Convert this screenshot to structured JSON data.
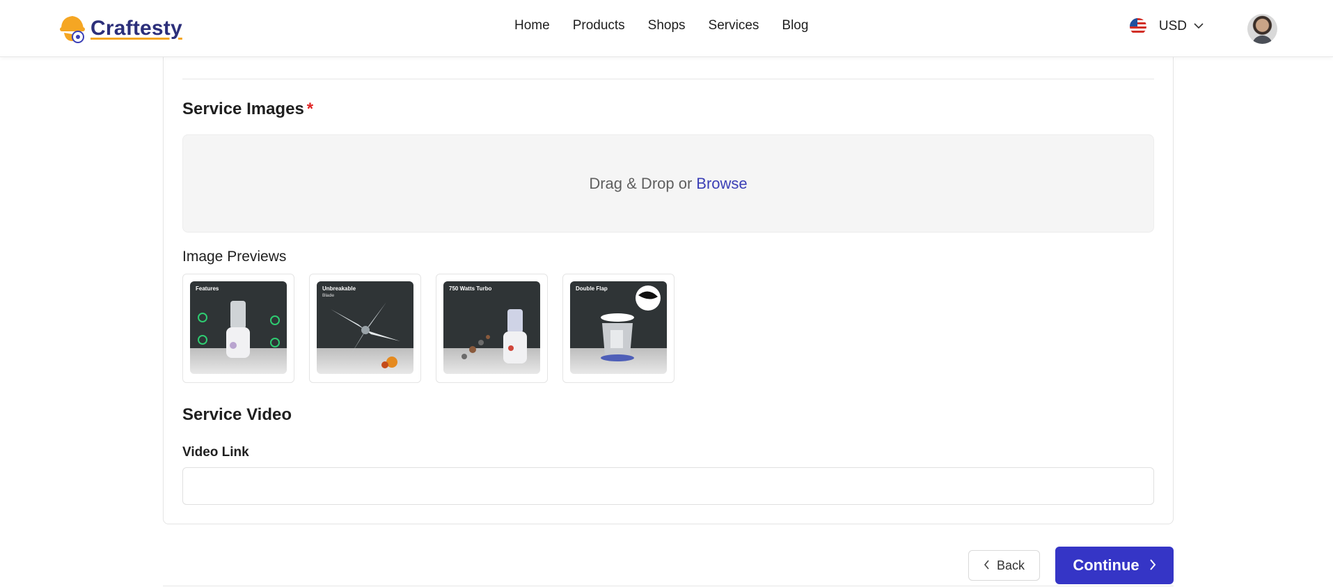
{
  "header": {
    "logo_text": "Craftesty",
    "nav": [
      {
        "label": "Home"
      },
      {
        "label": "Products"
      },
      {
        "label": "Shops"
      },
      {
        "label": "Services"
      },
      {
        "label": "Blog"
      }
    ],
    "currency": "USD",
    "flag_icon": "us-flag-icon",
    "accent_color": "#f5a623",
    "brand_color": "#2c2f7a"
  },
  "form": {
    "service_images_title": "Service Images",
    "required_mark": "*",
    "dropzone_text": "Drag & Drop or",
    "dropzone_link": "Browse",
    "image_previews_label": "Image Previews",
    "previews": [
      {
        "caption": "Features",
        "subcaption": ""
      },
      {
        "caption": "Unbreakable",
        "subcaption": "Blade"
      },
      {
        "caption": "750 Watts Turbo",
        "subcaption": ""
      },
      {
        "caption": "Double Flap",
        "subcaption": ""
      }
    ],
    "service_video_title": "Service Video",
    "video_link_label": "Video Link",
    "video_link_value": "",
    "video_link_placeholder": ""
  },
  "actions": {
    "back_label": "Back",
    "continue_label": "Continue",
    "continue_color": "#3535c6"
  }
}
